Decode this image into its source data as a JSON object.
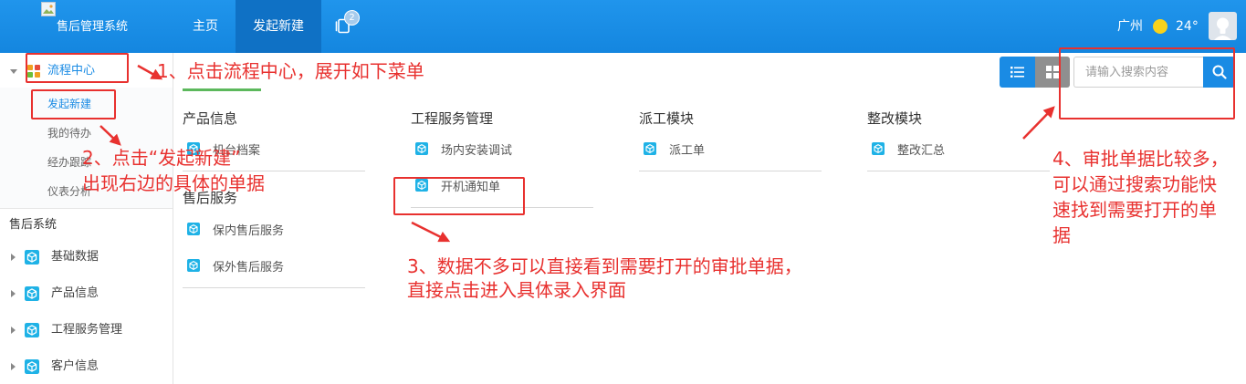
{
  "header": {
    "app_title": "售后管理系统",
    "nav": [
      {
        "label": "主页",
        "active": false
      },
      {
        "label": "发起新建",
        "active": true
      }
    ],
    "notification_badge": "2",
    "notification_icon": "window-stack-icon",
    "city": "广州",
    "weather_icon": "sun-icon",
    "temperature": "24°"
  },
  "sidebar": {
    "flow_center": {
      "label": "流程中心",
      "expanded": true,
      "items": [
        {
          "label": "发起新建",
          "active": true
        },
        {
          "label": "我的待办",
          "active": false
        },
        {
          "label": "经办跟踪",
          "active": false
        },
        {
          "label": "仪表分析",
          "active": false
        }
      ]
    },
    "section_title": "售后系统",
    "modules": [
      {
        "label": "基础数据",
        "expanded": false,
        "icon": "cube-icon"
      },
      {
        "label": "产品信息",
        "expanded": false,
        "icon": "cube-icon"
      },
      {
        "label": "工程服务管理",
        "expanded": false,
        "icon": "cube-icon"
      },
      {
        "label": "客户信息",
        "expanded": false,
        "icon": "cube-icon"
      }
    ]
  },
  "main": {
    "view_toggle": {
      "list_icon": "list-view-icon",
      "grid_icon": "grid-view-icon"
    },
    "search": {
      "placeholder": "请输入搜索内容",
      "value": "",
      "button_icon": "search-icon"
    },
    "categories": [
      {
        "title": "产品信息",
        "items": [
          "机台档案"
        ]
      },
      {
        "title": "售后服务",
        "items": [
          "保内售后服务",
          "保外售后服务"
        ]
      },
      {
        "title": "工程服务管理",
        "items": [
          "场内安装调试",
          "开机通知单"
        ]
      },
      {
        "title": "派工模块",
        "items": [
          "派工单"
        ]
      },
      {
        "title": "整改模块",
        "items": [
          "整改汇总"
        ]
      }
    ]
  },
  "annotations": {
    "step1": "1、点击流程中心，展开如下菜单",
    "step2": [
      "2、点击“发起新建”",
      "出现右边的具体的单据"
    ],
    "step3": [
      "3、数据不多可以直接看到需要打开的审批单据，",
      "直接点击进入具体录入界面"
    ],
    "step4": [
      "4、审批单据比较多，",
      "可以通过搜索功能快",
      "速找到需要打开的单",
      "据"
    ]
  },
  "colors": {
    "primary": "#1a8be4",
    "header_active": "#0f71c5",
    "tab_indicator": "#5cb85c",
    "icon_cyan": "#1fb2e6",
    "annotation_red": "#e8312f"
  }
}
